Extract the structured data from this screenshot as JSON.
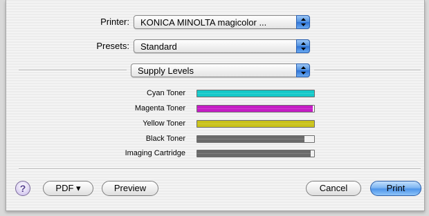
{
  "printer": {
    "label": "Printer:",
    "value": "KONICA MINOLTA magicolor ..."
  },
  "presets": {
    "label": "Presets:",
    "value": "Standard"
  },
  "panel": {
    "value": "Supply Levels"
  },
  "supplies": [
    {
      "name": "Cyan Toner",
      "level": 1.0,
      "color": "#16c9c9"
    },
    {
      "name": "Magenta Toner",
      "level": 0.99,
      "color": "#c51cc5"
    },
    {
      "name": "Yellow Toner",
      "level": 1.0,
      "color": "#c9c21a"
    },
    {
      "name": "Black Toner",
      "level": 0.92,
      "color": "#6a6a6a"
    },
    {
      "name": "Imaging Cartridge",
      "level": 0.97,
      "color": "#6a6a6a"
    }
  ],
  "buttons": {
    "help": "?",
    "pdf": "PDF ▾",
    "preview": "Preview",
    "cancel": "Cancel",
    "print": "Print"
  }
}
